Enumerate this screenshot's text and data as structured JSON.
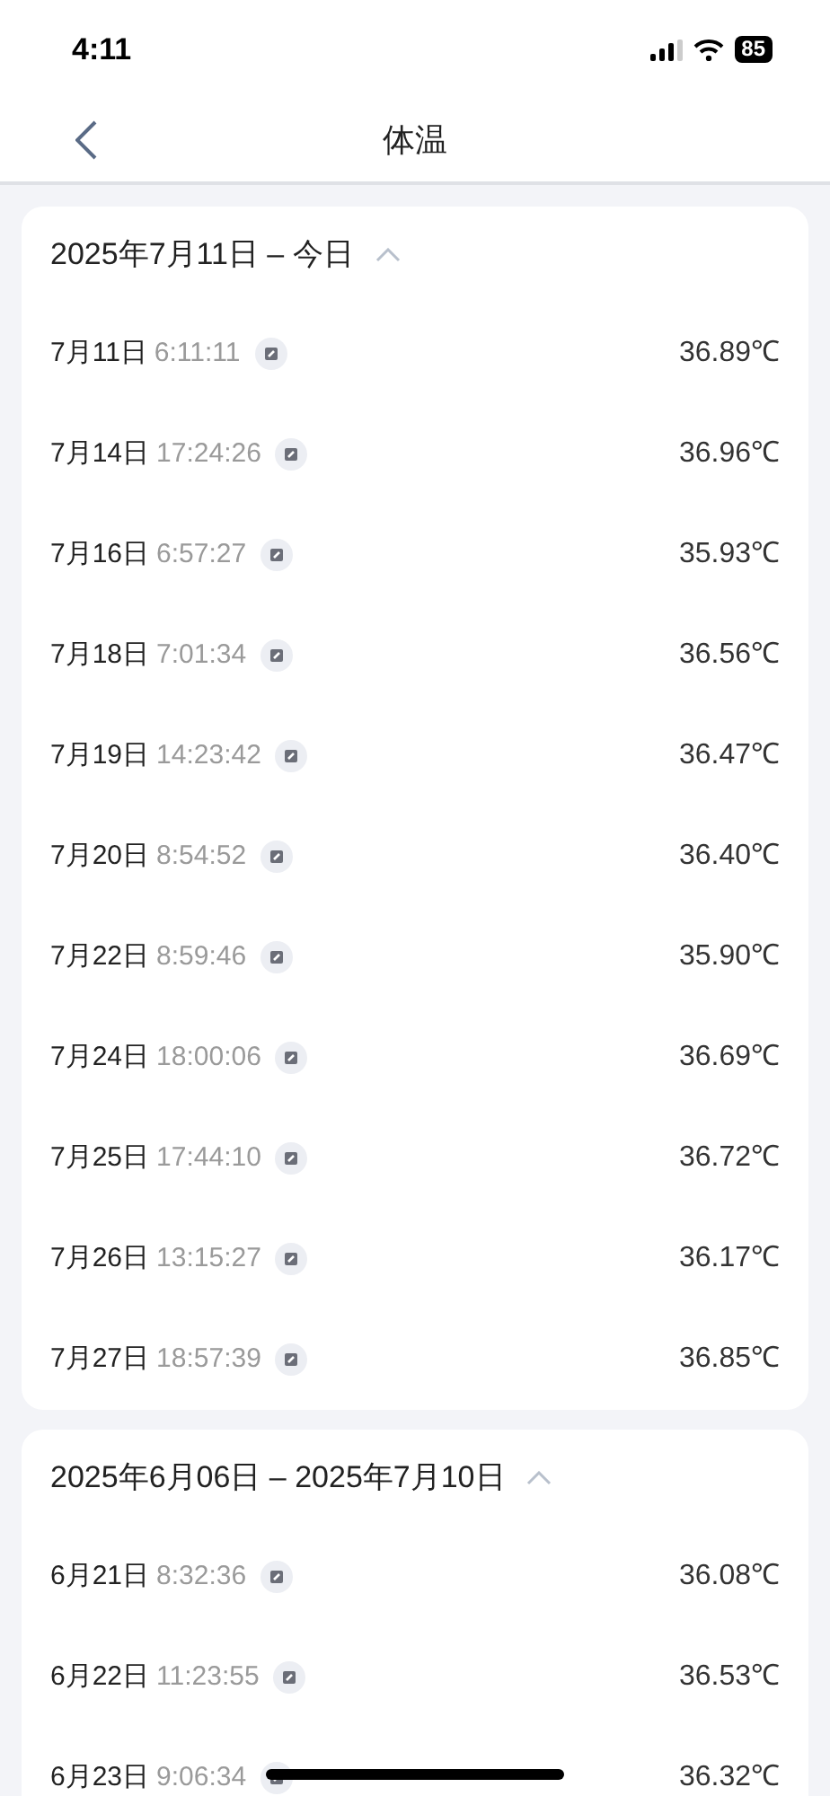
{
  "status_bar": {
    "time": "4:11",
    "battery": "85"
  },
  "nav": {
    "title": "体温"
  },
  "sections": [
    {
      "title": "2025年7月11日 – 今日",
      "expanded": true,
      "records": [
        {
          "date": "7月11日",
          "time": "6:11:11",
          "temperature": "36.89℃"
        },
        {
          "date": "7月14日",
          "time": "17:24:26",
          "temperature": "36.96℃"
        },
        {
          "date": "7月16日",
          "time": "6:57:27",
          "temperature": "35.93℃"
        },
        {
          "date": "7月18日",
          "time": "7:01:34",
          "temperature": "36.56℃"
        },
        {
          "date": "7月19日",
          "time": "14:23:42",
          "temperature": "36.47℃"
        },
        {
          "date": "7月20日",
          "time": "8:54:52",
          "temperature": "36.40℃"
        },
        {
          "date": "7月22日",
          "time": "8:59:46",
          "temperature": "35.90℃"
        },
        {
          "date": "7月24日",
          "time": "18:00:06",
          "temperature": "36.69℃"
        },
        {
          "date": "7月25日",
          "time": "17:44:10",
          "temperature": "36.72℃"
        },
        {
          "date": "7月26日",
          "time": "13:15:27",
          "temperature": "36.17℃"
        },
        {
          "date": "7月27日",
          "time": "18:57:39",
          "temperature": "36.85℃"
        }
      ]
    },
    {
      "title": "2025年6月06日 – 2025年7月10日",
      "expanded": true,
      "records": [
        {
          "date": "6月21日",
          "time": "8:32:36",
          "temperature": "36.08℃"
        },
        {
          "date": "6月22日",
          "time": "11:23:55",
          "temperature": "36.53℃"
        },
        {
          "date": "6月23日",
          "time": "9:06:34",
          "temperature": "36.32℃"
        }
      ]
    }
  ]
}
